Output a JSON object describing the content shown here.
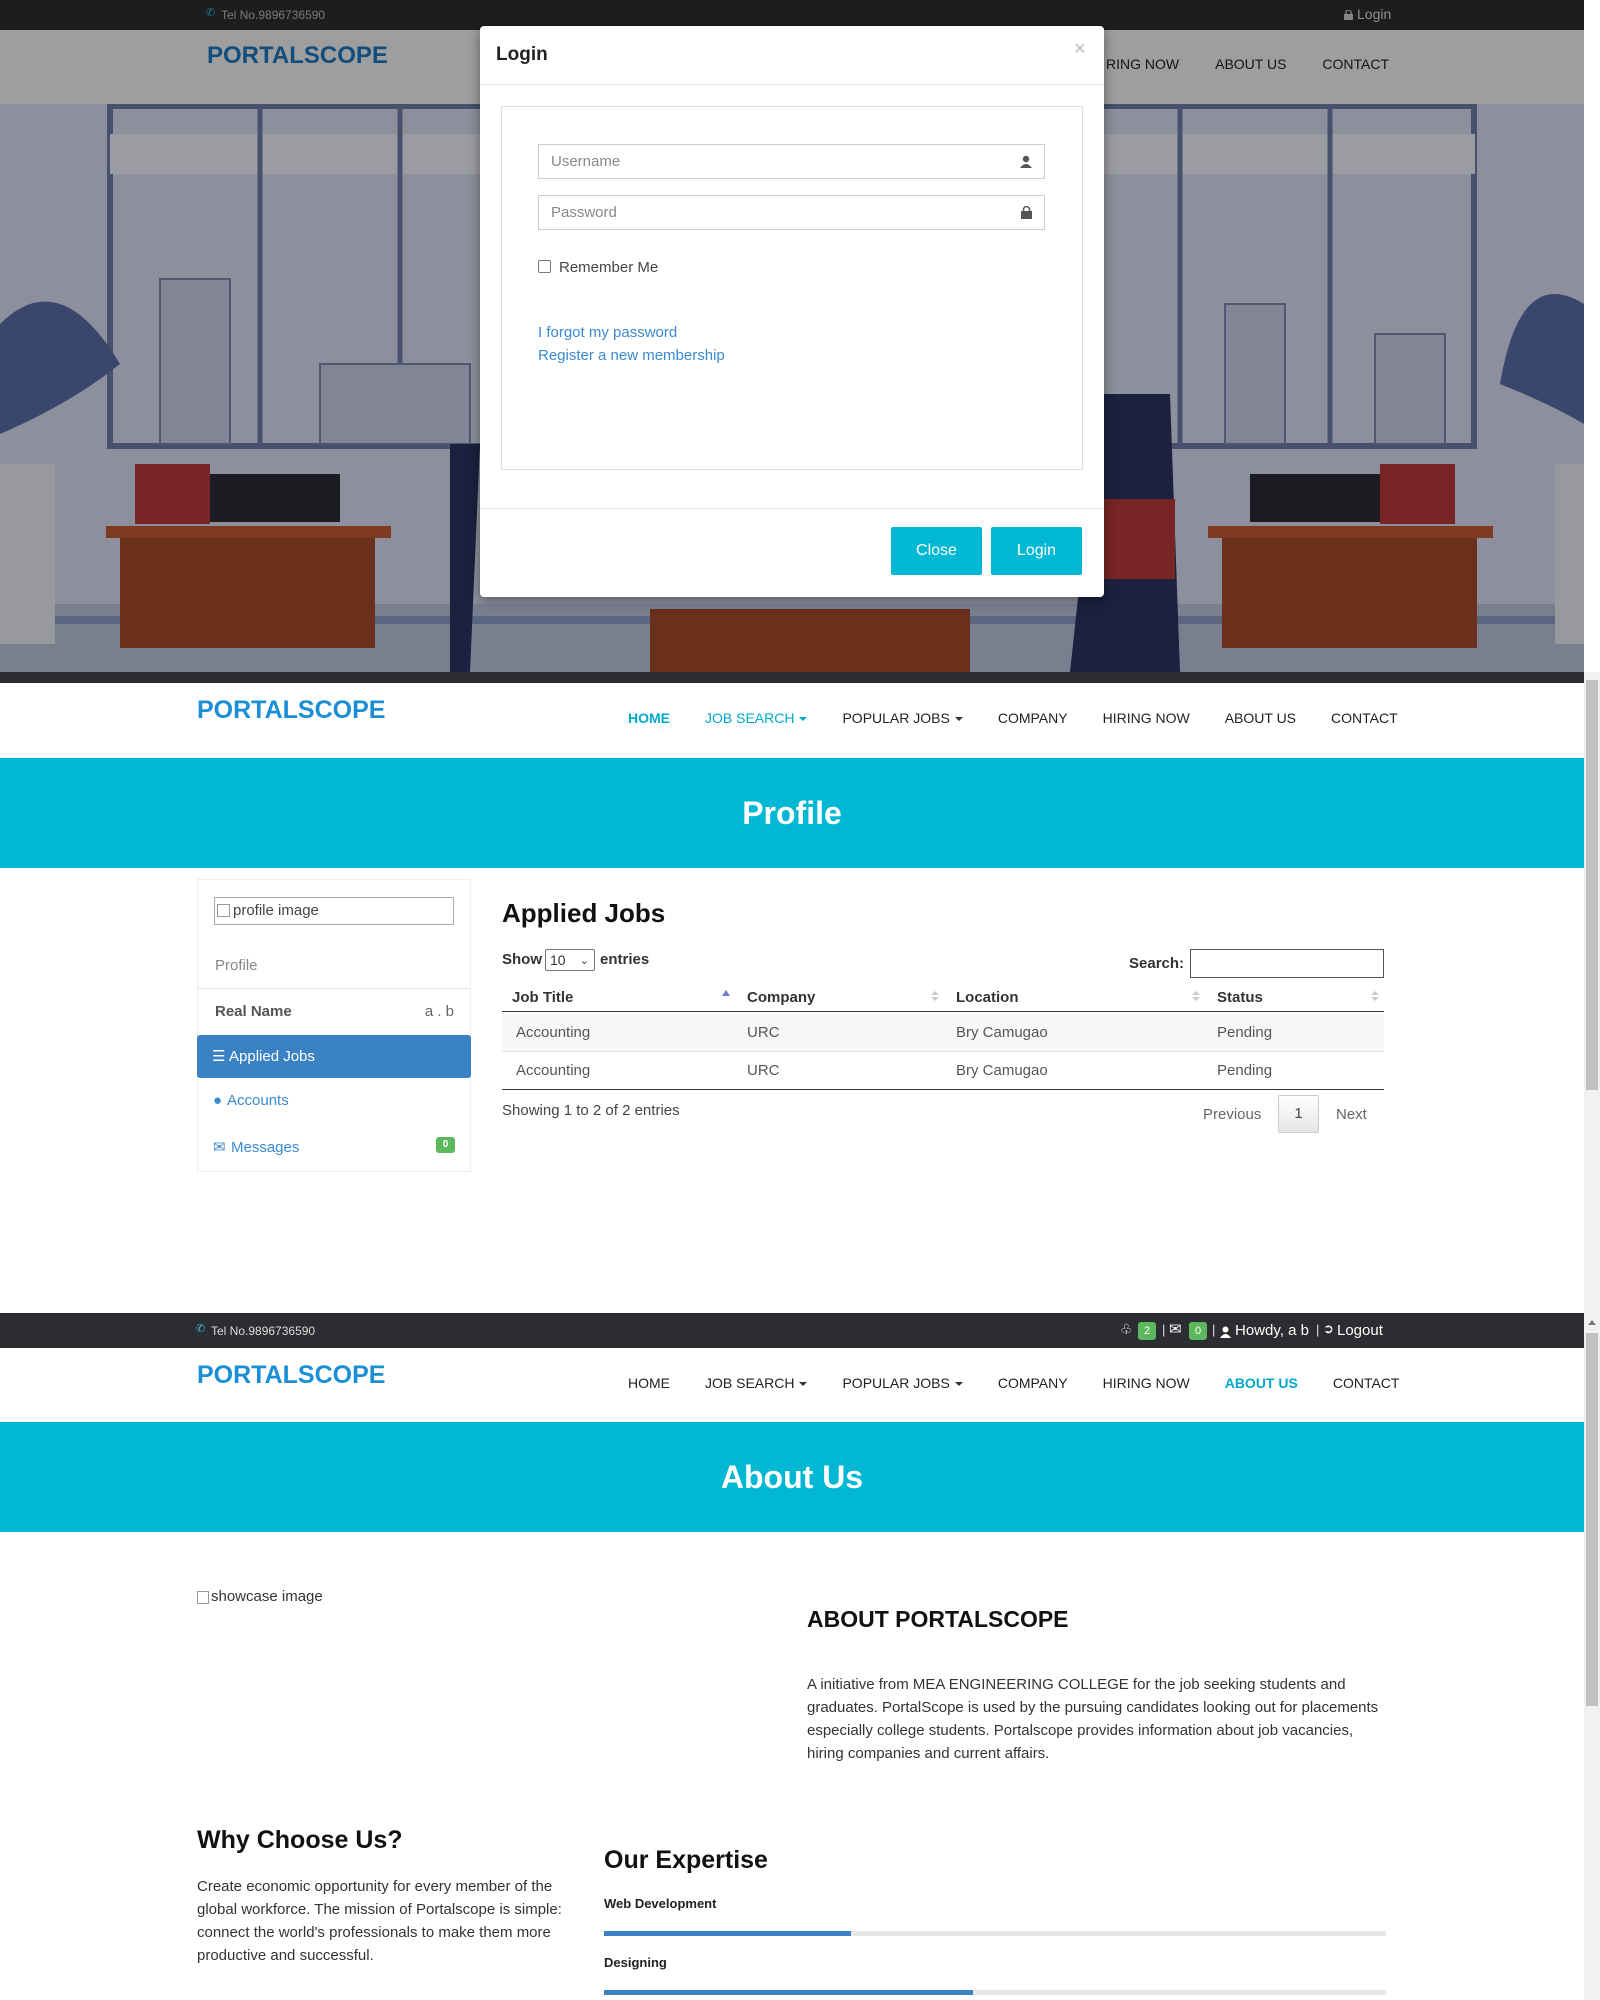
{
  "modal_section": {
    "topbar": {
      "phone": "Tel No.9896736590",
      "login": "Login"
    },
    "brand": "PORTALSCOPE",
    "nav_visible": [
      "RING NOW",
      "ABOUT US",
      "CONTACT"
    ],
    "modal": {
      "title": "Login",
      "close_x": "×",
      "username_placeholder": "Username",
      "password_placeholder": "Password",
      "remember_me": "Remember Me",
      "forgot_link": "I forgot my password",
      "register_link": "Register a new membership",
      "close_button": "Close",
      "login_button": "Login"
    }
  },
  "profile_section": {
    "brand": "PORTALSCOPE",
    "nav": [
      "HOME",
      "JOB SEARCH",
      "POPULAR JOBS",
      "COMPANY",
      "HIRING NOW",
      "ABOUT US",
      "CONTACT"
    ],
    "banner_title": "Profile",
    "sidebar": {
      "profile_image_alt": "profile image",
      "profile_label": "Profile",
      "real_name_label": "Real Name",
      "real_name_value": "a . b",
      "applied_jobs": "Applied Jobs",
      "accounts": "Accounts",
      "messages": "Messages",
      "messages_badge": "0"
    },
    "applied_jobs": {
      "heading": "Applied Jobs",
      "show_label": "Show",
      "entries_label": "entries",
      "entries_value": "10",
      "search_label": "Search:",
      "columns": [
        "Job Title",
        "Company",
        "Location",
        "Status"
      ],
      "rows": [
        [
          "Accounting",
          "URC",
          "Bry Camugao",
          "Pending"
        ],
        [
          "Accounting",
          "URC",
          "Bry Camugao",
          "Pending"
        ]
      ],
      "info": "Showing 1 to 2 of 2 entries",
      "pagination": {
        "previous": "Previous",
        "page": "1",
        "next": "Next"
      }
    }
  },
  "about_section": {
    "topbar": {
      "phone": "Tel No.9896736590",
      "notif_badge": "2",
      "mail_badge": "0",
      "greeting": "Howdy, a b",
      "logout": "Logout"
    },
    "brand": "PORTALSCOPE",
    "nav": [
      "HOME",
      "JOB SEARCH",
      "POPULAR JOBS",
      "COMPANY",
      "HIRING NOW",
      "ABOUT US",
      "CONTACT"
    ],
    "banner_title": "About Us",
    "showcase_alt": "showcase image",
    "about_heading": "ABOUT PORTALSCOPE",
    "about_text": "A initiative from MEA ENGINEERING COLLEGE for the job seeking students and graduates. PortalScope is used by the pursuing candidates looking out for placements especially college students. Portalscope provides information about job vacancies, hiring companies and current affairs.",
    "why_heading": "Why Choose Us?",
    "why_text": "Create economic opportunity for every member of the global workforce. The mission of Portalscope is simple: connect the world's professionals to make them more productive and successful.",
    "expertise_heading": "Our Expertise",
    "skills": [
      {
        "name": "Web Development",
        "level": 0.316
      },
      {
        "name": "Designing",
        "level": 0.472
      }
    ]
  },
  "colors": {
    "accent": "#00b8d4",
    "brand": "#1b8fd6",
    "topbar": "#2b2d30",
    "link": "#3a8ad0",
    "active_sidebar": "#3b82c4",
    "badge": "#5cb85c"
  }
}
